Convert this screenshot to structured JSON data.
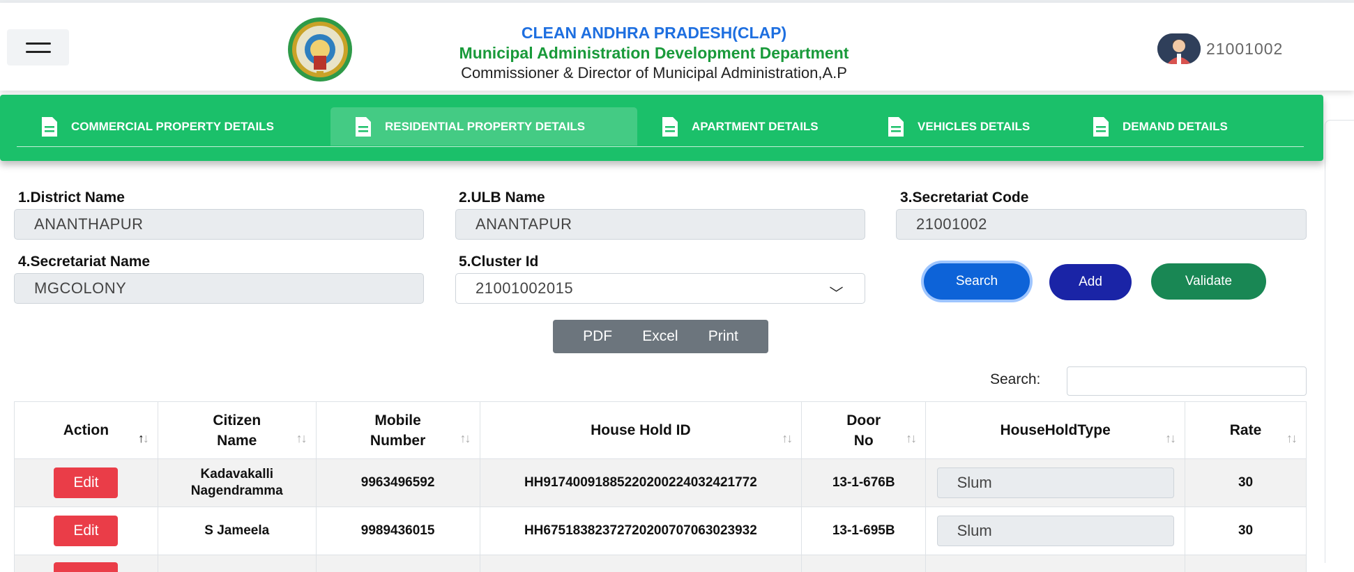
{
  "header": {
    "title1": "CLEAN ANDHRA PRADESH(CLAP)",
    "title2": "Municipal Administration Development Department",
    "title3": "Commissioner & Director of Municipal Administration,A.P",
    "user_id": "21001002"
  },
  "tabs": [
    {
      "label": "COMMERCIAL PROPERTY DETAILS"
    },
    {
      "label": "RESIDENTIAL PROPERTY DETAILS"
    },
    {
      "label": "APARTMENT DETAILS"
    },
    {
      "label": "VEHICLES DETAILS"
    },
    {
      "label": "DEMAND DETAILS"
    }
  ],
  "form": {
    "district_label": "1.District Name",
    "district_value": "ANANTHAPUR",
    "ulb_label": "2.ULB Name",
    "ulb_value": "ANANTAPUR",
    "sec_code_label": "3.Secretariat Code",
    "sec_code_value": "21001002",
    "sec_name_label": "4.Secretariat Name",
    "sec_name_value": "MGCOLONY",
    "cluster_label": "5.Cluster Id",
    "cluster_value": "21001002015"
  },
  "buttons": {
    "search": "Search",
    "add": "Add",
    "validate": "Validate"
  },
  "export": {
    "pdf": "PDF",
    "excel": "Excel",
    "print": "Print"
  },
  "table_search_label": "Search:",
  "table": {
    "columns": [
      "Action",
      "Citizen Name",
      "Mobile Number",
      "House Hold ID",
      "Door No",
      "HouseHoldType",
      "Rate"
    ],
    "rows": [
      {
        "action": "Edit",
        "name_line1": "Kadavakalli",
        "name_line2": "Nagendramma",
        "mobile": "9963496592",
        "hhid": "HH91740091885220200224032421772",
        "door": "13-1-676B",
        "type": "Slum",
        "rate": "30"
      },
      {
        "action": "Edit",
        "name_line1": "S Jameela",
        "name_line2": "",
        "mobile": "9989436015",
        "hhid": "HH67518382372720200707063023932",
        "door": "13-1-695B",
        "type": "Slum",
        "rate": "30"
      }
    ]
  }
}
